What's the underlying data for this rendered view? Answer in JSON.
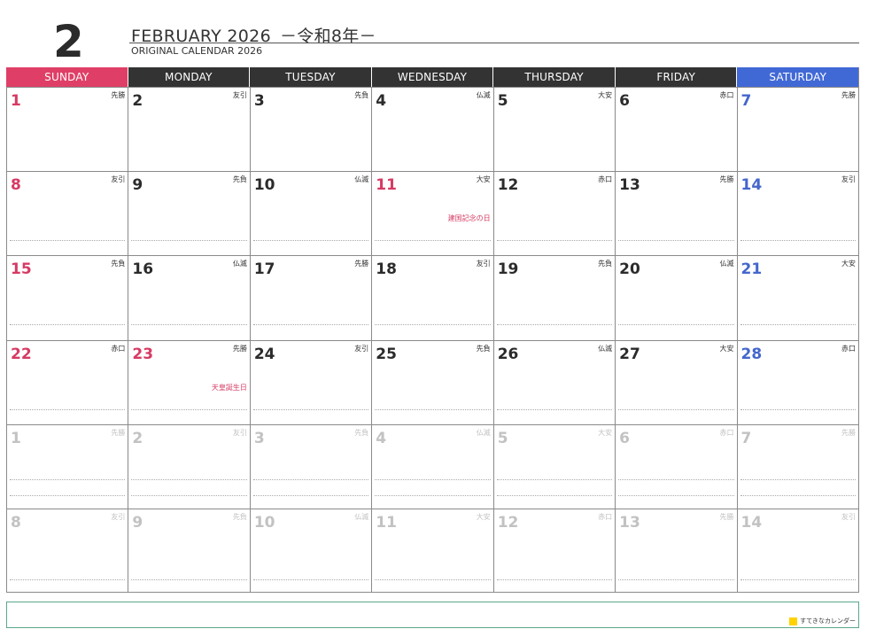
{
  "header": {
    "big_month": "2",
    "title": "FEBRUARY 2026",
    "era": "－令和8年－",
    "subtitle": "ORIGINAL CALENDAR 2026"
  },
  "weekdays": [
    "SUNDAY",
    "MONDAY",
    "TUESDAY",
    "WEDNESDAY",
    "THURSDAY",
    "FRIDAY",
    "SATURDAY"
  ],
  "colors": {
    "sunday": "#df3f66",
    "saturday": "#4169d6",
    "weekday_header": "#333333",
    "holiday_text": "#d63a63",
    "other_month": "#c2c2c2",
    "notes_border": "#5aa88a",
    "logo_square": "#ffd200"
  },
  "weeks": [
    [
      {
        "day": "1",
        "rokuyo": "先勝",
        "holiday": "",
        "other": false
      },
      {
        "day": "2",
        "rokuyo": "友引",
        "holiday": "",
        "other": false
      },
      {
        "day": "3",
        "rokuyo": "先負",
        "holiday": "",
        "other": false
      },
      {
        "day": "4",
        "rokuyo": "仏滅",
        "holiday": "",
        "other": false
      },
      {
        "day": "5",
        "rokuyo": "大安",
        "holiday": "",
        "other": false
      },
      {
        "day": "6",
        "rokuyo": "赤口",
        "holiday": "",
        "other": false
      },
      {
        "day": "7",
        "rokuyo": "先勝",
        "holiday": "",
        "other": false
      }
    ],
    [
      {
        "day": "8",
        "rokuyo": "友引",
        "holiday": "",
        "other": false
      },
      {
        "day": "9",
        "rokuyo": "先負",
        "holiday": "",
        "other": false
      },
      {
        "day": "10",
        "rokuyo": "仏滅",
        "holiday": "",
        "other": false
      },
      {
        "day": "11",
        "rokuyo": "大安",
        "holiday": "建国記念の日",
        "other": false
      },
      {
        "day": "12",
        "rokuyo": "赤口",
        "holiday": "",
        "other": false
      },
      {
        "day": "13",
        "rokuyo": "先勝",
        "holiday": "",
        "other": false
      },
      {
        "day": "14",
        "rokuyo": "友引",
        "holiday": "",
        "other": false
      }
    ],
    [
      {
        "day": "15",
        "rokuyo": "先負",
        "holiday": "",
        "other": false
      },
      {
        "day": "16",
        "rokuyo": "仏滅",
        "holiday": "",
        "other": false
      },
      {
        "day": "17",
        "rokuyo": "先勝",
        "holiday": "",
        "other": false
      },
      {
        "day": "18",
        "rokuyo": "友引",
        "holiday": "",
        "other": false
      },
      {
        "day": "19",
        "rokuyo": "先負",
        "holiday": "",
        "other": false
      },
      {
        "day": "20",
        "rokuyo": "仏滅",
        "holiday": "",
        "other": false
      },
      {
        "day": "21",
        "rokuyo": "大安",
        "holiday": "",
        "other": false
      }
    ],
    [
      {
        "day": "22",
        "rokuyo": "赤口",
        "holiday": "",
        "other": false
      },
      {
        "day": "23",
        "rokuyo": "先勝",
        "holiday": "天皇誕生日",
        "other": false
      },
      {
        "day": "24",
        "rokuyo": "友引",
        "holiday": "",
        "other": false
      },
      {
        "day": "25",
        "rokuyo": "先負",
        "holiday": "",
        "other": false
      },
      {
        "day": "26",
        "rokuyo": "仏滅",
        "holiday": "",
        "other": false
      },
      {
        "day": "27",
        "rokuyo": "大安",
        "holiday": "",
        "other": false
      },
      {
        "day": "28",
        "rokuyo": "赤口",
        "holiday": "",
        "other": false
      }
    ],
    [
      {
        "day": "1",
        "rokuyo": "先勝",
        "holiday": "",
        "other": true
      },
      {
        "day": "2",
        "rokuyo": "友引",
        "holiday": "",
        "other": true
      },
      {
        "day": "3",
        "rokuyo": "先負",
        "holiday": "",
        "other": true
      },
      {
        "day": "4",
        "rokuyo": "仏滅",
        "holiday": "",
        "other": true
      },
      {
        "day": "5",
        "rokuyo": "大安",
        "holiday": "",
        "other": true
      },
      {
        "day": "6",
        "rokuyo": "赤口",
        "holiday": "",
        "other": true
      },
      {
        "day": "7",
        "rokuyo": "先勝",
        "holiday": "",
        "other": true
      }
    ],
    [
      {
        "day": "8",
        "rokuyo": "友引",
        "holiday": "",
        "other": true
      },
      {
        "day": "9",
        "rokuyo": "先負",
        "holiday": "",
        "other": true
      },
      {
        "day": "10",
        "rokuyo": "仏滅",
        "holiday": "",
        "other": true
      },
      {
        "day": "11",
        "rokuyo": "大安",
        "holiday": "",
        "other": true
      },
      {
        "day": "12",
        "rokuyo": "赤口",
        "holiday": "",
        "other": true
      },
      {
        "day": "13",
        "rokuyo": "先勝",
        "holiday": "",
        "other": true
      },
      {
        "day": "14",
        "rokuyo": "友引",
        "holiday": "",
        "other": true
      }
    ]
  ],
  "logo": {
    "text": "すてきなカレンダー"
  }
}
